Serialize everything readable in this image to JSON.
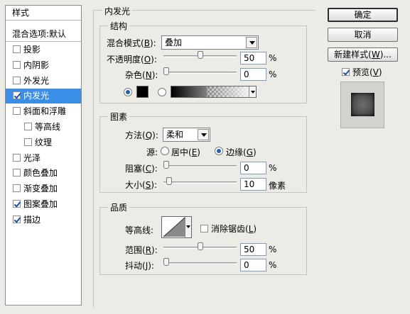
{
  "styles_list": {
    "header": "样式",
    "blend_options": "混合选项:默认",
    "items": [
      {
        "label": "投影",
        "checked": false,
        "sub": false
      },
      {
        "label": "内阴影",
        "checked": false,
        "sub": false
      },
      {
        "label": "外发光",
        "checked": false,
        "sub": false
      },
      {
        "label": "内发光",
        "checked": true,
        "sub": false,
        "selected": true
      },
      {
        "label": "斜面和浮雕",
        "checked": false,
        "sub": false
      },
      {
        "label": "等高线",
        "checked": false,
        "sub": true
      },
      {
        "label": "纹理",
        "checked": false,
        "sub": true
      },
      {
        "label": "光泽",
        "checked": false,
        "sub": false
      },
      {
        "label": "颜色叠加",
        "checked": false,
        "sub": false
      },
      {
        "label": "渐变叠加",
        "checked": false,
        "sub": false
      },
      {
        "label": "图案叠加",
        "checked": true,
        "sub": false
      },
      {
        "label": "描边",
        "checked": true,
        "sub": false
      }
    ]
  },
  "inner_glow": {
    "title": "内发光",
    "structure": {
      "title": "结构",
      "blend_mode_label": "混合模式",
      "blend_mode_key": "B",
      "blend_mode_value": "叠加",
      "opacity_label": "不透明度",
      "opacity_key": "O",
      "opacity_value": "50",
      "opacity_unit": "%",
      "opacity_level": 50,
      "noise_label": "杂色",
      "noise_key": "N",
      "noise_value": "0",
      "noise_unit": "%",
      "noise_level": 0,
      "color_mode": "solid",
      "solid_color": "#000000"
    },
    "elements": {
      "title": "图素",
      "technique_label": "方法",
      "technique_key": "Q",
      "technique_value": "柔和",
      "source_label": "源:",
      "source_center_label": "居中",
      "source_center_key": "E",
      "source_edge_label": "边缘",
      "source_edge_key": "G",
      "source_selected": "edge",
      "choke_label": "阻塞",
      "choke_key": "C",
      "choke_value": "0",
      "choke_unit": "%",
      "choke_level": 0,
      "size_label": "大小",
      "size_key": "S",
      "size_value": "10",
      "size_unit": "像素",
      "size_level": 4
    },
    "quality": {
      "title": "品质",
      "contour_label": "等高线:",
      "anti_alias_label": "消除锯齿",
      "anti_alias_key": "L",
      "anti_alias_checked": false,
      "range_label": "范围",
      "range_key": "R",
      "range_value": "50",
      "range_unit": "%",
      "range_level": 50,
      "jitter_label": "抖动",
      "jitter_key": "J",
      "jitter_value": "0",
      "jitter_unit": "%",
      "jitter_level": 0
    }
  },
  "buttons": {
    "ok": "确定",
    "cancel": "取消",
    "new_style": "新建样式",
    "new_style_key": "W",
    "new_style_suffix": "...",
    "preview_label": "预览",
    "preview_key": "V",
    "preview_checked": true
  },
  "colors": {
    "selection": "#3a8ee6",
    "dialog_bg": "#ecebe6"
  }
}
